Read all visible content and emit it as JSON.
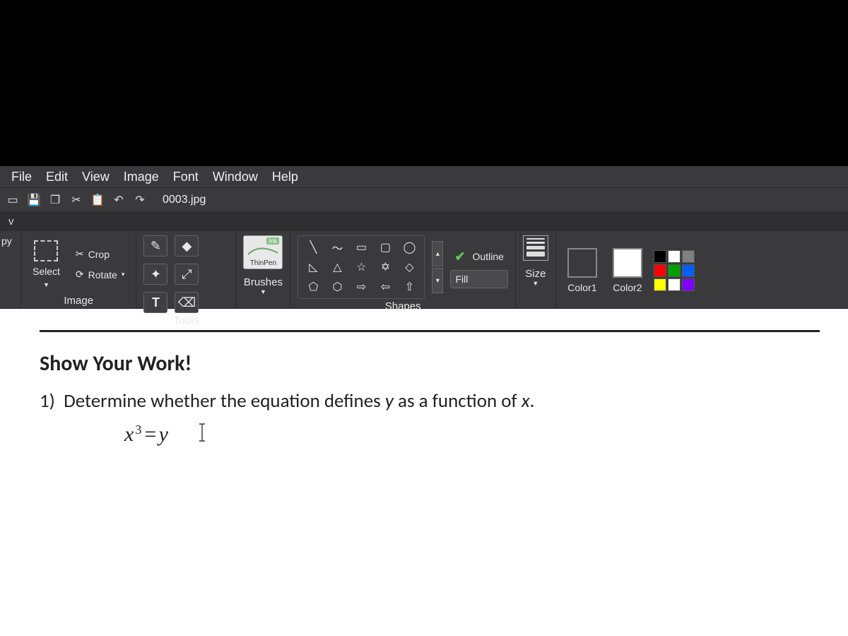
{
  "menubar": {
    "items": [
      "File",
      "Edit",
      "View",
      "Image",
      "Font",
      "Window",
      "Help"
    ]
  },
  "filename": "0003.jpg",
  "ribbon_tab_left": "v",
  "copy_label_fragment": "py",
  "groups": {
    "image": {
      "label": "Image",
      "select": "Select",
      "crop": "Crop",
      "rotate": "Rotate"
    },
    "tools": {
      "label": "Tools"
    },
    "brushes": {
      "label": "Brushes",
      "thinpen": "ThinPen",
      "ink": "Ink"
    },
    "shapes": {
      "label": "Shapes",
      "outline": "Outline",
      "fill": "Fill"
    },
    "size": {
      "label": "Size"
    },
    "colors": {
      "color1": "Color1",
      "color2": "Color2"
    },
    "palette": [
      "#000000",
      "#ffffff",
      "#808080",
      "#ff0000",
      "#00a000",
      "#0060ff",
      "#ffff00",
      "#ffffff",
      "#8000ff"
    ]
  },
  "document": {
    "heading": "Show Your Work!",
    "question_number": "1)",
    "question_text_a": "Determine whether the equation defines ",
    "question_var_y": "y",
    "question_text_b": " as a function of ",
    "question_var_x": "x",
    "question_text_c": ".",
    "eq_base": "x",
    "eq_exp": "3",
    "eq_mid": " = ",
    "eq_rhs": "y"
  }
}
